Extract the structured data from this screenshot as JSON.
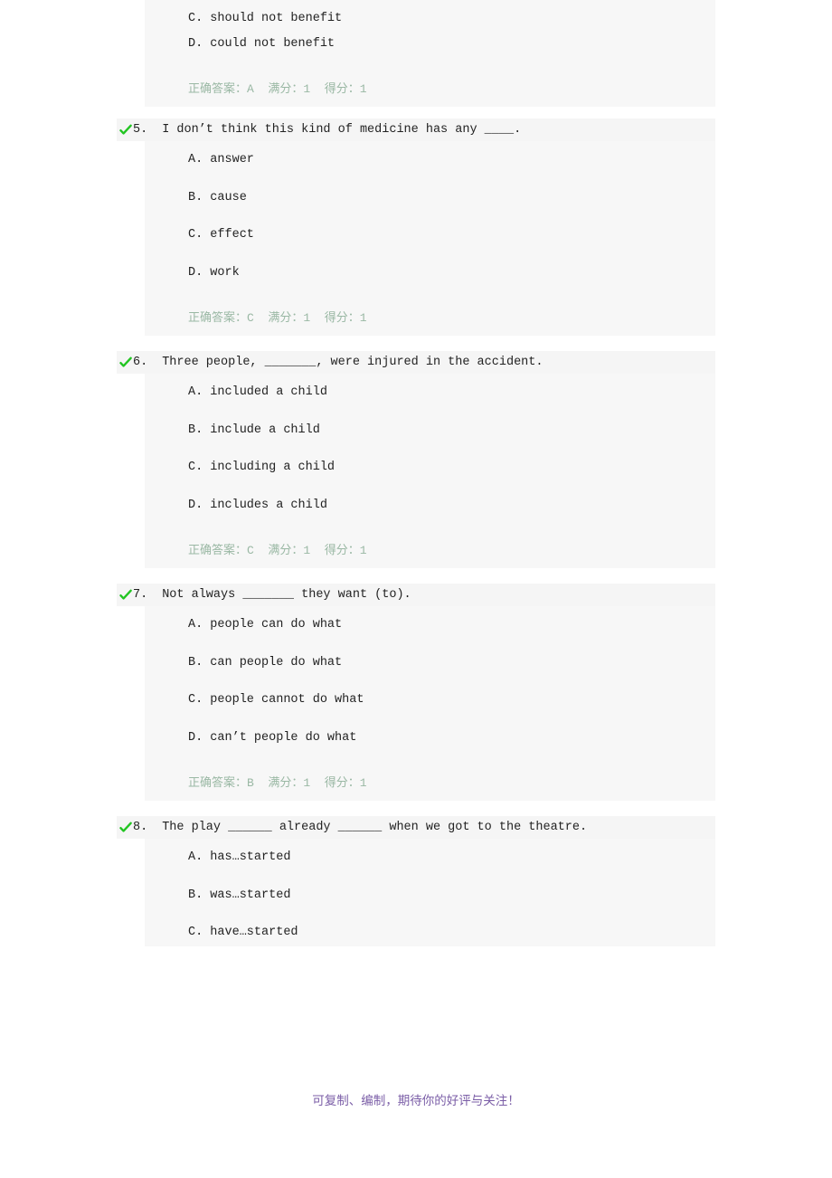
{
  "document": {
    "type": "online-quiz-result",
    "footer_note": "可复制、编制，期待你的好评与关注！",
    "footer_color": "#7b5ea7",
    "check_color": "#22c522",
    "answer_color": "#9ab8a4",
    "header_bg": "#f5f5f5",
    "body_bg": "#f7f7f7",
    "page_bg": "#ffffff"
  },
  "answer_labels": {
    "correct": "正确答案：",
    "full_score": "满分：",
    "score": "得分："
  },
  "questions": [
    {
      "number": "",
      "stem": "",
      "partial_top": true,
      "checked": false,
      "options": [
        "C. should not benefit",
        "D. could not benefit"
      ],
      "answer_line": "正确答案：A  满分：1  得分：1",
      "correct": "A",
      "full_score": "1",
      "score": "1"
    },
    {
      "number": "5.",
      "stem": "I don’t think this kind of medicine has any ____.",
      "checked": true,
      "check_icon": "check-mark-icon",
      "options": [
        "A. answer",
        "B. cause",
        "C. effect",
        "D. work"
      ],
      "answer_line": "正确答案：C  满分：1  得分：1",
      "correct": "C",
      "full_score": "1",
      "score": "1"
    },
    {
      "number": "6.",
      "stem": "Three people, _______, were injured in the accident.",
      "checked": true,
      "check_icon": "check-mark-icon",
      "options": [
        "A. included a child",
        "B. include a child",
        "C. including a child",
        "D. includes a child"
      ],
      "answer_line": "正确答案：C  满分：1  得分：1",
      "correct": "C",
      "full_score": "1",
      "score": "1"
    },
    {
      "number": "7.",
      "stem": "Not always _______ they want (to).",
      "checked": true,
      "check_icon": "check-mark-icon",
      "options": [
        "A. people can do what",
        "B. can people do what",
        "C. people cannot do what",
        "D. can’t people do what"
      ],
      "answer_line": "正确答案：B  满分：1  得分：1",
      "correct": "B",
      "full_score": "1",
      "score": "1"
    },
    {
      "number": "8.",
      "stem": "The play ______ already ______ when we got to the theatre.",
      "checked": true,
      "check_icon": "check-mark-icon",
      "partial_bottom": true,
      "options": [
        "A. has…started",
        "B. was…started",
        "C. have…started"
      ],
      "answer_line": "",
      "correct": "",
      "full_score": "",
      "score": ""
    }
  ]
}
